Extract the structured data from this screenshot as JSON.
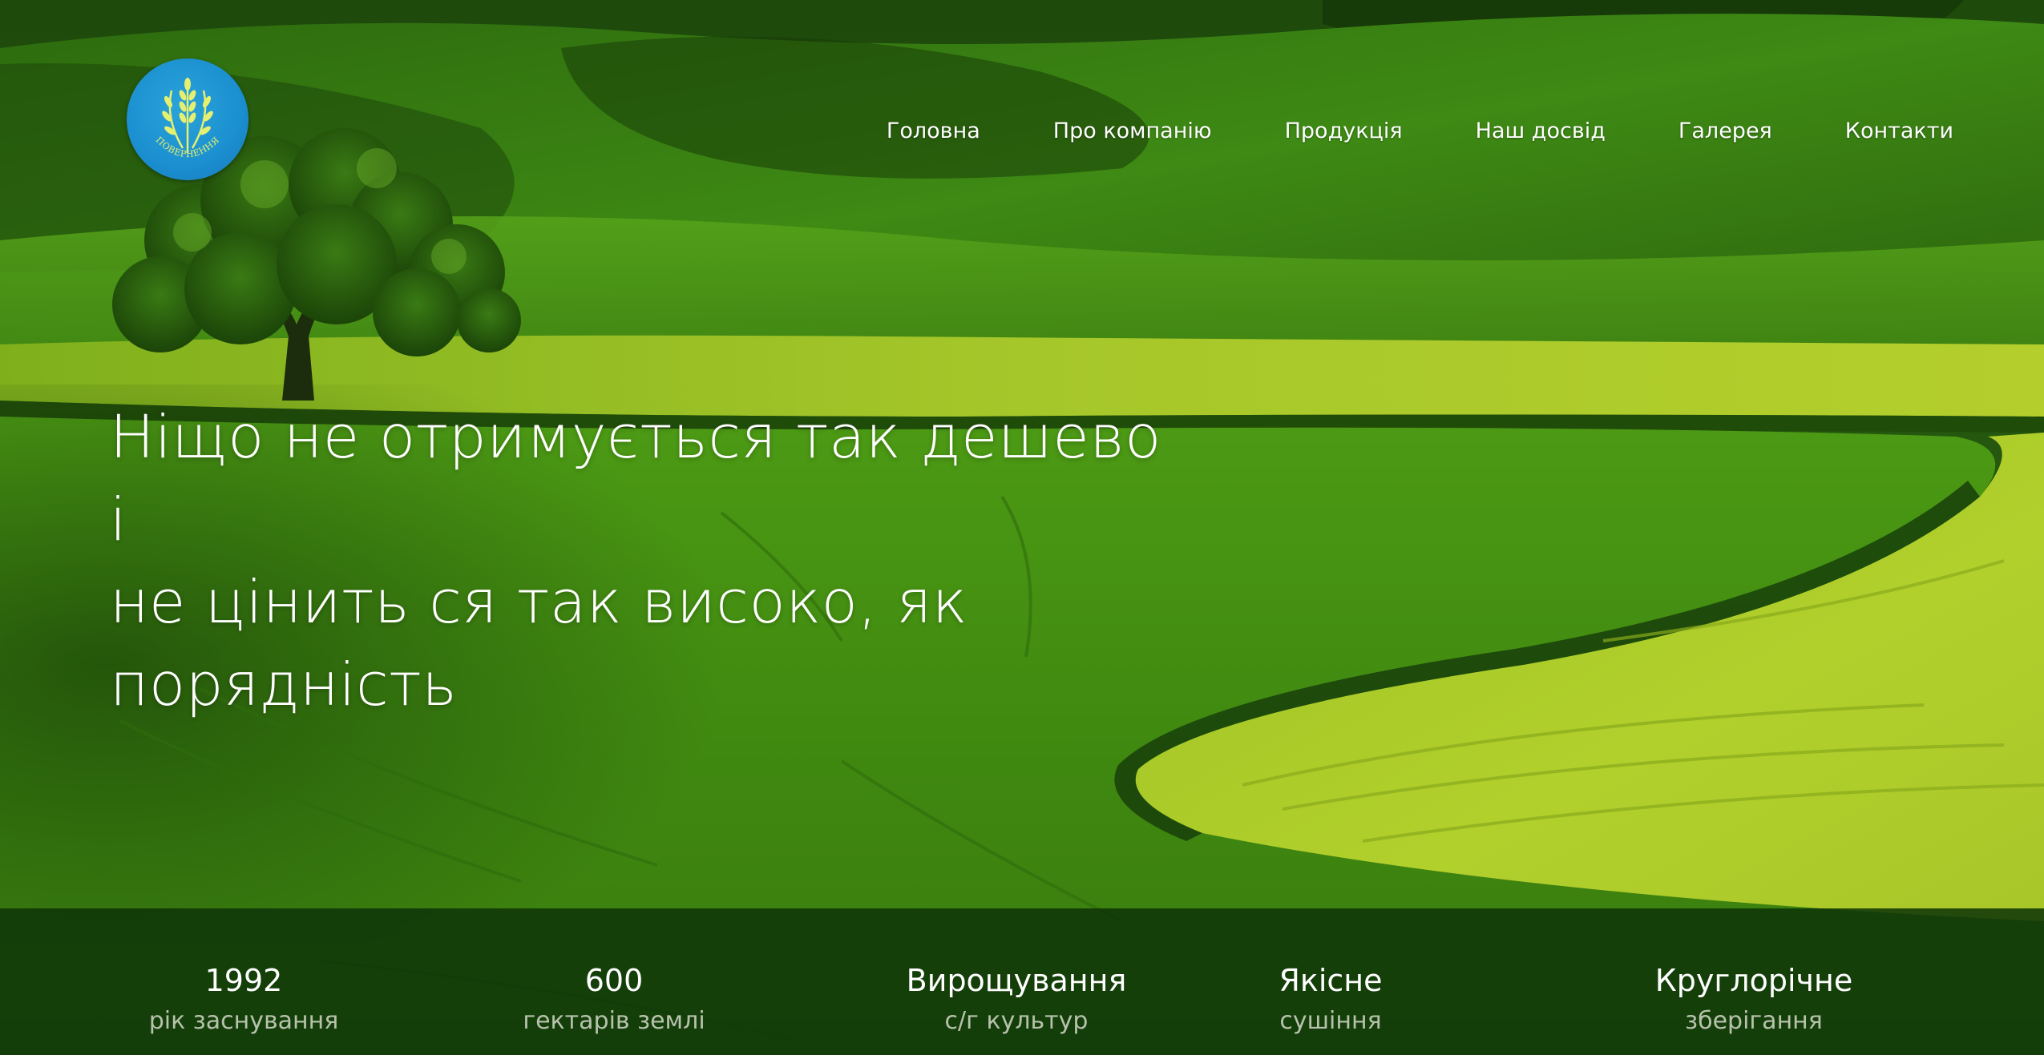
{
  "logo": {
    "text": "ПОВЕРНЕННЯ",
    "background_color": "#1b8fd0",
    "emblem_color": "#e6f070",
    "icon": "wheat-wreath-icon"
  },
  "nav": {
    "items": [
      {
        "label": "Головна"
      },
      {
        "label": "Про компанію"
      },
      {
        "label": "Продукція"
      },
      {
        "label": "Наш досвід"
      },
      {
        "label": "Галерея"
      },
      {
        "label": "Контакти"
      }
    ]
  },
  "hero": {
    "headline_lines": [
      "Ніщо не отримується так дешево і",
      "не цінить ся так високо, як",
      "порядність"
    ]
  },
  "stats": [
    {
      "value": "1992",
      "label": "рік заснування"
    },
    {
      "value": "600",
      "label": "гектарів землі"
    },
    {
      "value": "Вирощування",
      "label": "с/г культур"
    },
    {
      "value": "Якісне",
      "label": "сушіння"
    },
    {
      "value": "Круглорічне",
      "label": "зберігання"
    }
  ],
  "colors": {
    "stats_bar": "#0e3408",
    "stat_label": "#b7c2ad",
    "text": "#ffffff"
  }
}
